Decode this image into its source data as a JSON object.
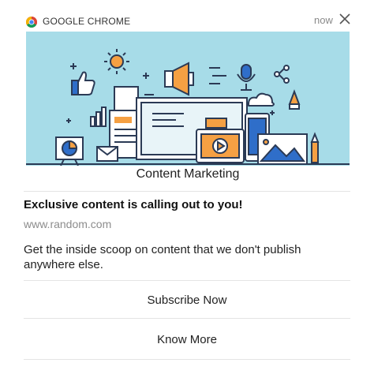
{
  "notification": {
    "app_name": "GOOGLE CHROME",
    "time": "now",
    "banner_caption": "Content Marketing",
    "title": "Exclusive content is calling out to you!",
    "url": "www.random.com",
    "message": "Get the inside scoop on content that we don't publish anywhere else.",
    "actions": [
      "Subscribe Now",
      "Know More"
    ]
  },
  "colors": {
    "banner_bg": "#a7dce8",
    "accent_orange": "#f5a043",
    "accent_blue": "#2f6ec9",
    "outline": "#2b3a55"
  }
}
